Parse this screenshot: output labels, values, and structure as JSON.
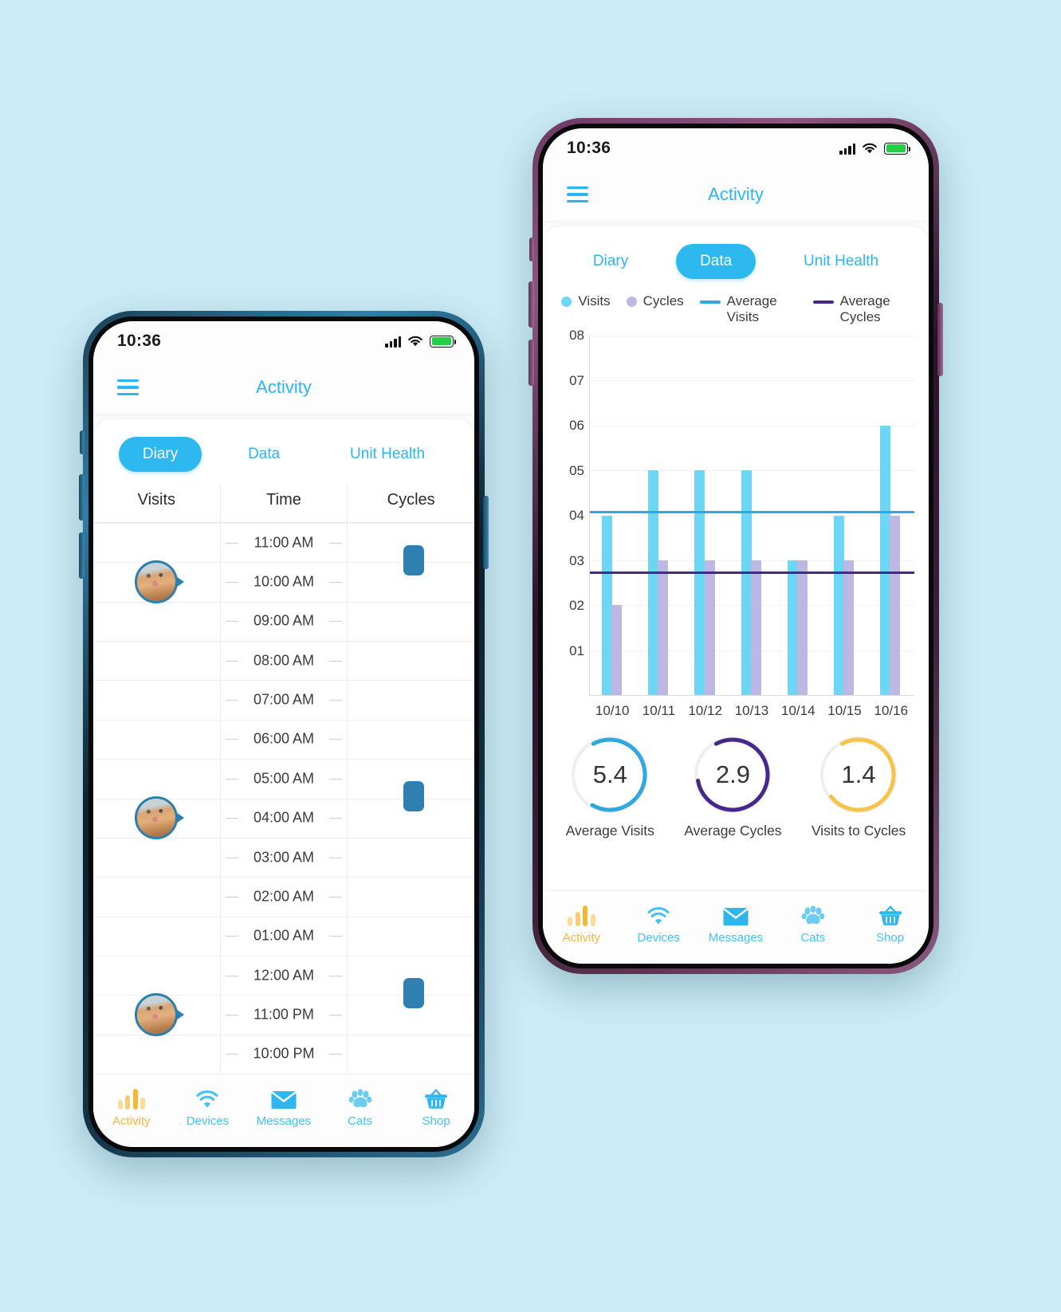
{
  "status_bar": {
    "time": "10:36",
    "signal_icon": "signal-bars-icon",
    "wifi_icon": "wifi-icon",
    "battery_icon": "battery-icon"
  },
  "header": {
    "title": "Activity",
    "menu_icon": "hamburger-menu-icon"
  },
  "tabs": [
    {
      "label": "Diary"
    },
    {
      "label": "Data"
    },
    {
      "label": "Unit Health"
    }
  ],
  "left_phone": {
    "active_tab": "Diary",
    "table_headers": [
      "Visits",
      "Time",
      "Cycles"
    ],
    "time_labels": [
      "11:00 AM",
      "10:00 AM",
      "09:00 AM",
      "08:00 AM",
      "07:00 AM",
      "06:00 AM",
      "05:00 AM",
      "04:00 AM",
      "03:00 AM",
      "02:00 AM",
      "01:00 AM",
      "12:00 AM",
      "11:00 PM",
      "10:00 PM"
    ],
    "visit_markers": [
      {
        "time": "10:00 AM",
        "icon": "cat-avatar"
      },
      {
        "time": "04:00 AM",
        "icon": "cat-avatar"
      },
      {
        "time": "11:00 PM",
        "icon": "cat-avatar"
      }
    ],
    "cycle_markers": [
      {
        "time": "10:30 AM"
      },
      {
        "time": "04:30 AM"
      },
      {
        "time": "11:30 PM"
      }
    ]
  },
  "right_phone": {
    "active_tab": "Data",
    "legend": [
      {
        "label": "Visits",
        "type": "dot",
        "color": "#6ed6f5",
        "icon": "visits-dot-icon"
      },
      {
        "label": "Cycles",
        "type": "dot",
        "color": "#bdb7e3",
        "icon": "cycles-dot-icon"
      },
      {
        "label": "Average Visits",
        "type": "line",
        "color": "#2fa8e0",
        "icon": "average-visits-line-icon"
      },
      {
        "label": "Average Cycles",
        "type": "line",
        "color": "#45288a",
        "icon": "average-cycles-line-icon"
      }
    ],
    "metrics": [
      {
        "value": "5.4",
        "label": "Average Visits",
        "color": "#2fa8e0",
        "pct": 0.66
      },
      {
        "value": "2.9",
        "label": "Average Cycles",
        "color": "#45288a",
        "pct": 0.8
      },
      {
        "value": "1.4",
        "label": "Visits to Cycles",
        "color": "#f5c449",
        "pct": 0.72
      }
    ]
  },
  "chart_data": {
    "type": "bar",
    "title": "",
    "xlabel": "",
    "ylabel": "",
    "ylim": [
      0,
      8
    ],
    "yticks": [
      "01",
      "02",
      "03",
      "04",
      "05",
      "06",
      "07",
      "08"
    ],
    "grid": true,
    "legend_position": "top",
    "categories": [
      "10/10",
      "10/11",
      "10/12",
      "10/13",
      "10/14",
      "10/15",
      "10/16"
    ],
    "series": [
      {
        "name": "Visits",
        "color": "#6ed6f5",
        "values": [
          4,
          5,
          5,
          5,
          3,
          4,
          6
        ]
      },
      {
        "name": "Cycles",
        "color": "#bdb7e3",
        "values": [
          2,
          3,
          3,
          3,
          3,
          3,
          4
        ]
      }
    ],
    "reference_lines": [
      {
        "name": "Average Visits",
        "value": 4.05,
        "color": "#2fa8e0"
      },
      {
        "name": "Average Cycles",
        "value": 2.7,
        "color": "#45288a"
      }
    ]
  },
  "bottom_nav": [
    {
      "label": "Activity",
      "icon": "bar-chart-icon",
      "active": true
    },
    {
      "label": "Devices",
      "icon": "wifi-icon",
      "active": false
    },
    {
      "label": "Messages",
      "icon": "envelope-icon",
      "active": false
    },
    {
      "label": "Cats",
      "icon": "paw-icon",
      "active": false
    },
    {
      "label": "Shop",
      "icon": "basket-icon",
      "active": false
    }
  ]
}
